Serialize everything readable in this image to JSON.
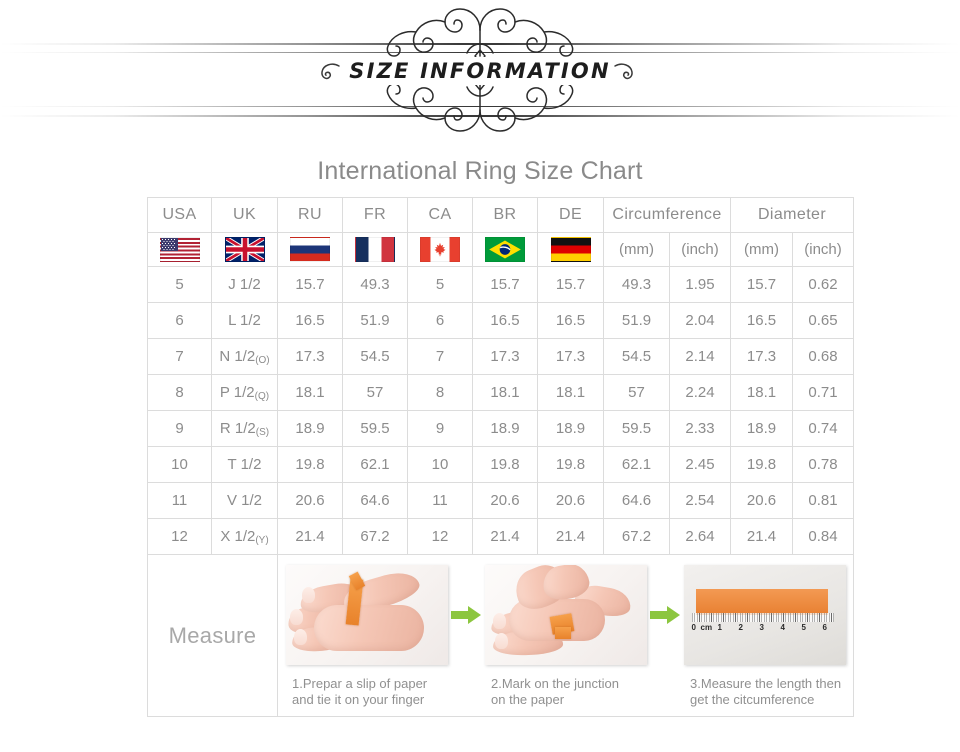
{
  "banner": {
    "title": "SIZE INFORMATION"
  },
  "chart": {
    "title": "International Ring Size Chart"
  },
  "table": {
    "headers": [
      {
        "label": "USA",
        "flag": "flag-usa-icon",
        "colspan": 1,
        "rowspan": 2
      },
      {
        "label": "UK",
        "flag": "flag-uk-icon",
        "colspan": 1,
        "rowspan": 2
      },
      {
        "label": "RU",
        "flag": "flag-russia-icon",
        "colspan": 1,
        "rowspan": 2
      },
      {
        "label": "FR",
        "flag": "flag-france-icon",
        "colspan": 1,
        "rowspan": 2
      },
      {
        "label": "CA",
        "flag": "flag-canada-icon",
        "colspan": 1,
        "rowspan": 2
      },
      {
        "label": "BR",
        "flag": "flag-brazil-icon",
        "colspan": 1,
        "rowspan": 2
      },
      {
        "label": "DE",
        "flag": "flag-germany-icon",
        "colspan": 1,
        "rowspan": 2
      }
    ],
    "group_headers": [
      {
        "label": "Circumference",
        "units": [
          "(mm)",
          "(inch)"
        ]
      },
      {
        "label": "Diameter",
        "units": [
          "(mm)",
          "(inch)"
        ]
      }
    ],
    "column_names": [
      "USA",
      "UK",
      "RU",
      "FR",
      "CA",
      "BR",
      "DE",
      "Circumference (mm)",
      "Circumference (inch)",
      "Diameter (mm)",
      "Diameter (inch)"
    ],
    "rows": [
      {
        "usa": "5",
        "uk": "J 1/2",
        "uk_sub": "",
        "ru": "15.7",
        "fr": "49.3",
        "ca": "5",
        "br": "15.7",
        "de": "15.7",
        "circ_mm": "49.3",
        "circ_in": "1.95",
        "dia_mm": "15.7",
        "dia_in": "0.62"
      },
      {
        "usa": "6",
        "uk": "L 1/2",
        "uk_sub": "",
        "ru": "16.5",
        "fr": "51.9",
        "ca": "6",
        "br": "16.5",
        "de": "16.5",
        "circ_mm": "51.9",
        "circ_in": "2.04",
        "dia_mm": "16.5",
        "dia_in": "0.65"
      },
      {
        "usa": "7",
        "uk": "N 1/2",
        "uk_sub": "(O)",
        "ru": "17.3",
        "fr": "54.5",
        "ca": "7",
        "br": "17.3",
        "de": "17.3",
        "circ_mm": "54.5",
        "circ_in": "2.14",
        "dia_mm": "17.3",
        "dia_in": "0.68"
      },
      {
        "usa": "8",
        "uk": "P 1/2",
        "uk_sub": "(Q)",
        "ru": "18.1",
        "fr": "57",
        "ca": "8",
        "br": "18.1",
        "de": "18.1",
        "circ_mm": "57",
        "circ_in": "2.24",
        "dia_mm": "18.1",
        "dia_in": "0.71"
      },
      {
        "usa": "9",
        "uk": "R 1/2",
        "uk_sub": "(S)",
        "ru": "18.9",
        "fr": "59.5",
        "ca": "9",
        "br": "18.9",
        "de": "18.9",
        "circ_mm": "59.5",
        "circ_in": "2.33",
        "dia_mm": "18.9",
        "dia_in": "0.74"
      },
      {
        "usa": "10",
        "uk": "T 1/2",
        "uk_sub": "",
        "ru": "19.8",
        "fr": "62.1",
        "ca": "10",
        "br": "19.8",
        "de": "19.8",
        "circ_mm": "62.1",
        "circ_in": "2.45",
        "dia_mm": "19.8",
        "dia_in": "0.78"
      },
      {
        "usa": "11",
        "uk": "V 1/2",
        "uk_sub": "",
        "ru": "20.6",
        "fr": "64.6",
        "ca": "11",
        "br": "20.6",
        "de": "20.6",
        "circ_mm": "64.6",
        "circ_in": "2.54",
        "dia_mm": "20.6",
        "dia_in": "0.81"
      },
      {
        "usa": "12",
        "uk": "X 1/2",
        "uk_sub": "(Y)",
        "ru": "21.4",
        "fr": "67.2",
        "ca": "12",
        "br": "21.4",
        "de": "21.4",
        "circ_mm": "67.2",
        "circ_in": "2.64",
        "dia_mm": "21.4",
        "dia_in": "0.84"
      }
    ]
  },
  "measure": {
    "label": "Measure",
    "steps": [
      {
        "caption_line1": "1.Prepar a slip of paper",
        "caption_line2": "and tie it on your finger"
      },
      {
        "caption_line1": "2.Mark on the junction",
        "caption_line2": "on the paper"
      },
      {
        "caption_line1": "3.Measure the length then",
        "caption_line2": "get the citcumference"
      }
    ],
    "ruler_ticks": [
      "0",
      "cm",
      "1",
      "2",
      "3",
      "4",
      "5",
      "6"
    ],
    "arrow_color": "#8cc63f"
  },
  "colors": {
    "text_grey": "#8c8c8c",
    "border_grey": "#dcdcdc",
    "title_grey": "#8a8a8a",
    "banner_black": "#1d1d1d"
  }
}
